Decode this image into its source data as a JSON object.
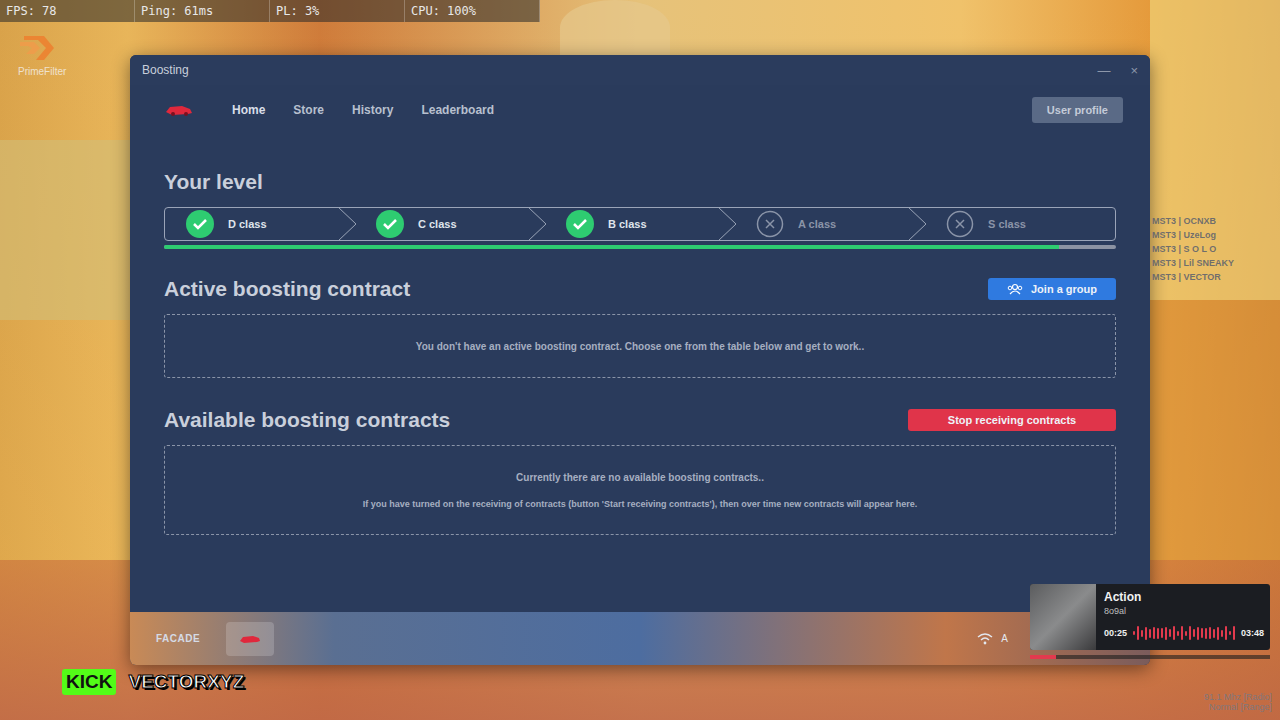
{
  "hud": {
    "stats": [
      "FPS: 78",
      "Ping: 61ms",
      "PL: 3%",
      "CPU: 100%"
    ]
  },
  "overlay_logo": {
    "text": "PrimeFilter"
  },
  "window": {
    "title": "Boosting",
    "controls": [
      "—",
      "×"
    ]
  },
  "nav": {
    "items": [
      {
        "label": "Home",
        "selected": true
      },
      {
        "label": "Store",
        "selected": false
      },
      {
        "label": "History",
        "selected": false
      },
      {
        "label": "Leaderboard",
        "selected": false
      }
    ],
    "profile_button": "User profile"
  },
  "level": {
    "title": "Your level",
    "steps": [
      {
        "label": "D class",
        "done": true
      },
      {
        "label": "C class",
        "done": true
      },
      {
        "label": "B class",
        "done": true
      },
      {
        "label": "A class",
        "done": false
      },
      {
        "label": "S class",
        "done": false
      }
    ],
    "level": 0.94
  },
  "active": {
    "title": "Active boosting contract",
    "button": "Join a group",
    "empty": "You don't have an active boosting contract. Choose one from the table below and get to work.."
  },
  "available": {
    "title": "Available boosting contracts",
    "button": "Stop receiving contracts",
    "empty": [
      "Currently there are no available boosting contracts..",
      "If you have turned on the receiving of contracts (button 'Start receiving contracts'), then over time new contracts will appear here."
    ]
  },
  "taskbar": {
    "apps": [
      {
        "label": "FACADE",
        "selected": false
      },
      {
        "label": "",
        "selected": true
      }
    ],
    "status_text": "A"
  },
  "players": [
    "MST3 | OCNXB",
    "MST3 | UzeLog",
    "MST3 | S O L O",
    "MST3 | Lil SNEAKY",
    "MST3 | VECTOR"
  ],
  "music": {
    "title": "Action",
    "artist": "8o9al",
    "elapsed": "00:25",
    "total": "03:48",
    "level": 0.11
  },
  "stream": {
    "platform": "KICK",
    "channel": "VECTORXYZ"
  },
  "radio": [
    "91.1 Mhz [Radio]",
    "Normal [Range]"
  ]
}
